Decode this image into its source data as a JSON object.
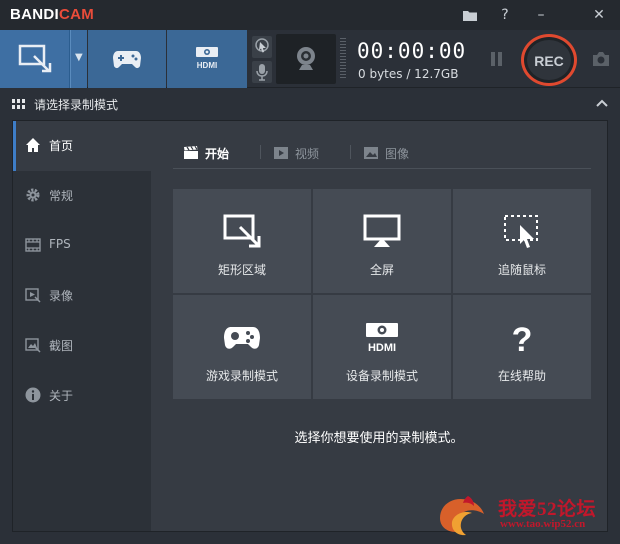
{
  "app": {
    "brand_a": "BANDI",
    "brand_b": "CAM"
  },
  "colors": {
    "accent": "#3e6fa3",
    "rec": "#e0492f",
    "brand_red": "#e94c3a",
    "active_bar": "#3e7dc7"
  },
  "titlebar": {
    "icons": [
      "folder-icon",
      "help-icon",
      "minimize-icon",
      "close-icon"
    ],
    "help_label": "?",
    "minimize_label": "–",
    "close_label": "✕"
  },
  "toolbar": {
    "hdmi_label": "HDMI",
    "timer": "00:00:00",
    "size": "0 bytes / 12.7GB",
    "rec_label": "REC"
  },
  "section": {
    "title": "请选择录制模式"
  },
  "sidebar": {
    "items": [
      {
        "label": "首页",
        "icon": "home-icon",
        "active": true
      },
      {
        "label": "常规",
        "icon": "gear-icon",
        "active": false
      },
      {
        "label": "FPS",
        "icon": "fps-icon",
        "active": false
      },
      {
        "label": "录像",
        "icon": "video-icon",
        "active": false
      },
      {
        "label": "截图",
        "icon": "image-icon",
        "active": false
      },
      {
        "label": "关于",
        "icon": "info-icon",
        "active": false
      }
    ]
  },
  "tabs": [
    {
      "label": "开始",
      "icon": "clapper-icon",
      "active": true
    },
    {
      "label": "视频",
      "icon": "play-icon",
      "active": false
    },
    {
      "label": "图像",
      "icon": "picture-icon",
      "active": false
    }
  ],
  "tiles": [
    {
      "label": "矩形区域",
      "icon": "rectangle-area-icon"
    },
    {
      "label": "全屏",
      "icon": "fullscreen-icon"
    },
    {
      "label": "追随鼠标",
      "icon": "follow-mouse-icon"
    },
    {
      "label": "游戏录制模式",
      "icon": "gamepad-icon"
    },
    {
      "label": "设备录制模式",
      "icon": "hdmi-device-icon",
      "badge": "HDMI"
    },
    {
      "label": "在线帮助",
      "icon": "question-icon",
      "badge": "?"
    }
  ],
  "hint": "选择你想要使用的录制模式。",
  "watermark": {
    "line1": "我爱52论坛",
    "line2": "www.tao.wip52.cn"
  }
}
